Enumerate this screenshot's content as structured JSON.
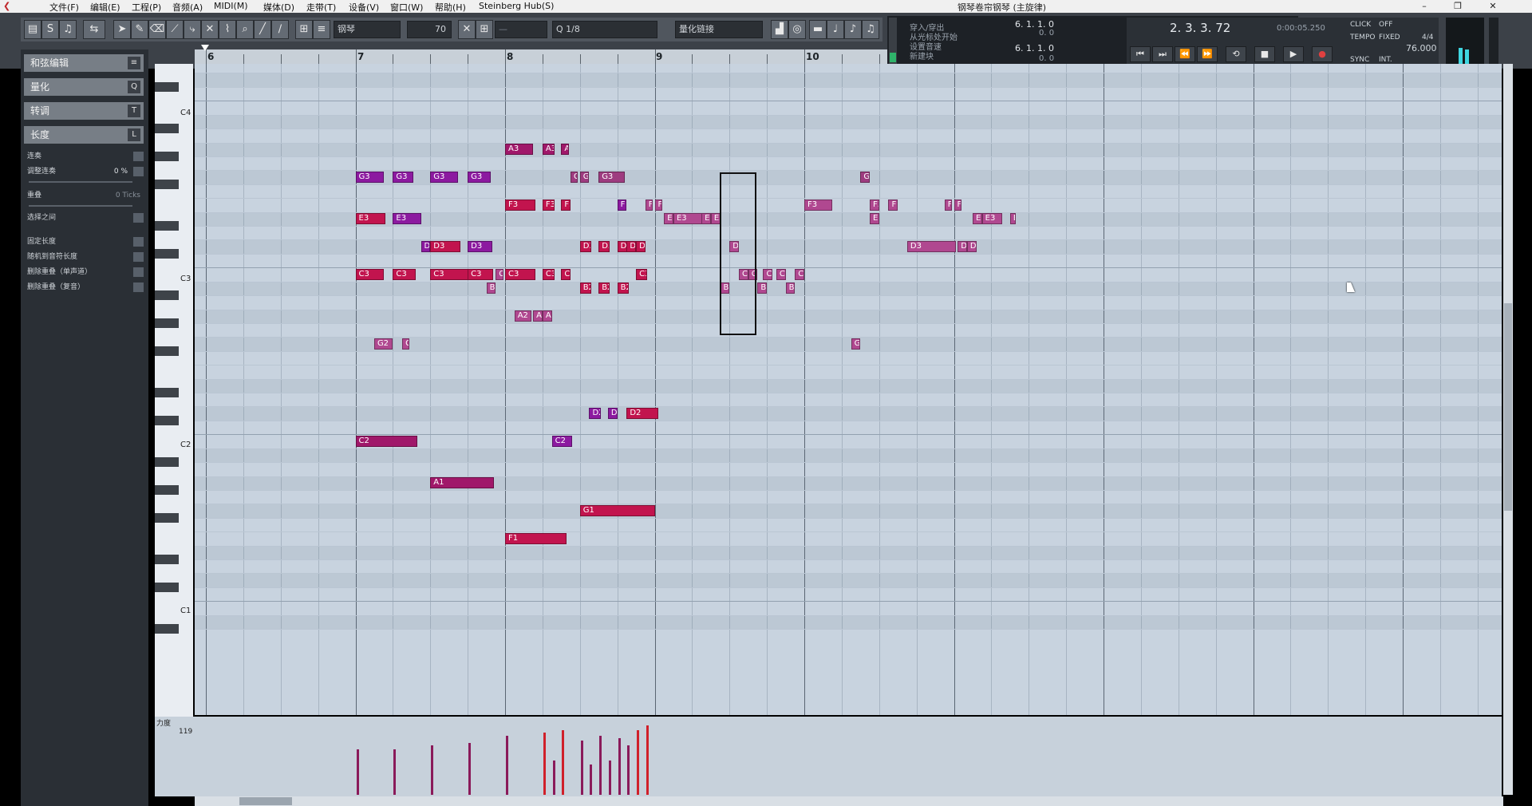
{
  "app": {
    "window_title": "钢琴卷帘钢琴 (主旋律)",
    "menu": [
      "文件(F)",
      "编辑(E)",
      "工程(P)",
      "音频(A)",
      "MIDI(M)",
      "媒体(D)",
      "走带(T)",
      "设备(V)",
      "窗口(W)",
      "帮助(H)",
      "Steinberg Hub(S)"
    ],
    "window_buttons": [
      "–",
      "❐",
      "✕"
    ]
  },
  "toolbar": {
    "track_name": "钢琴",
    "velocity_value": "70",
    "quantize": "1/8",
    "quantize_mode": "量化链接",
    "icons": [
      "tool-arrow-icon",
      "pencil-icon",
      "eraser-icon",
      "scissors-icon",
      "glue-icon",
      "mute-icon",
      "zoom-icon",
      "line-icon"
    ]
  },
  "info_panel": {
    "rows": [
      "穿入/穿出",
      "从光标处开始",
      "设置音速",
      "新建块"
    ],
    "locator_left": "6. 1. 1.  0",
    "locator_left_sub": "0.  0",
    "locator_right": "6. 1. 1.  0",
    "locator_right_sub": "0.  0"
  },
  "transport": {
    "position": "2. 3. 3.  72",
    "time": "0:00:05.250",
    "buttons": [
      "⏮",
      "⏭",
      "⏪",
      "⏩",
      "⟲",
      "■",
      "▶",
      "●"
    ]
  },
  "click_panel": {
    "click": "CLICK",
    "click_state": "OFF",
    "tempo": "TEMPO",
    "tempo_mode": "FIXED",
    "signature": "4/4",
    "tempo_value": "76.000",
    "sync": "SYNC",
    "sync_mode": "INT."
  },
  "inspector": {
    "headers": [
      {
        "label": "和弦编辑",
        "key": "≡"
      },
      {
        "label": "量化",
        "key": "Q"
      },
      {
        "label": "转调",
        "key": "T"
      },
      {
        "label": "长度",
        "key": "L"
      }
    ],
    "rows": [
      {
        "label": "连奏",
        "value": ""
      },
      {
        "label": "调整连奏",
        "value": "0 %"
      },
      {
        "label": "重叠",
        "value": "0 Ticks"
      },
      {
        "label": "选择之间",
        "value": ""
      },
      {
        "label": "固定长度",
        "value": ""
      },
      {
        "label": "随机到音符长度",
        "value": ""
      },
      {
        "label": "删除重叠（单声道）",
        "value": ""
      },
      {
        "label": "删除重叠（复音）",
        "value": ""
      }
    ]
  },
  "keyboard": {
    "labels": [
      {
        "text": "C4",
        "row": 0
      },
      {
        "text": "C3",
        "row": 1
      },
      {
        "text": "C2",
        "row": 2
      },
      {
        "text": "C1",
        "row": 3
      }
    ]
  },
  "ruler": {
    "bars": [
      "6",
      "7",
      "8",
      "9",
      "10"
    ]
  },
  "notes": [
    {
      "n": "A3",
      "p": 21,
      "s": 0,
      "w": 0.75,
      "c": "#a0186a"
    },
    {
      "n": "A3",
      "p": 21,
      "s": 1.0,
      "w": 0.33,
      "c": "#a0186a"
    },
    {
      "n": "A3",
      "p": 21,
      "s": 1.5,
      "w": 0.2,
      "c": "#a0186a"
    },
    {
      "n": "G3",
      "p": 19,
      "s": -4,
      "w": 0.75,
      "c": "#8c1aa0"
    },
    {
      "n": "G3",
      "p": 19,
      "s": -3,
      "w": 0.55,
      "c": "#8c1aa0"
    },
    {
      "n": "G3",
      "p": 19,
      "s": -2,
      "w": 0.75,
      "c": "#8c1aa0"
    },
    {
      "n": "G3",
      "p": 19,
      "s": -1,
      "w": 0.62,
      "c": "#8c1aa0"
    },
    {
      "n": "G3",
      "p": 19,
      "s": 1.75,
      "w": 0.2,
      "c": "#9e3c80"
    },
    {
      "n": "G3",
      "p": 19,
      "s": 2.0,
      "w": 0.25,
      "c": "#9e3c80"
    },
    {
      "n": "G3",
      "p": 19,
      "s": 2.5,
      "w": 0.7,
      "c": "#9e3c80"
    },
    {
      "n": "G3",
      "p": 19,
      "s": 9.5,
      "w": 0.25,
      "c": "#9e3c80"
    },
    {
      "n": "F3",
      "p": 17,
      "s": 0,
      "w": 0.8,
      "c": "#c2144e"
    },
    {
      "n": "F3",
      "p": 17,
      "s": 1.0,
      "w": 0.33,
      "c": "#c2144e"
    },
    {
      "n": "F3",
      "p": 17,
      "s": 1.5,
      "w": 0.25,
      "c": "#c2144e"
    },
    {
      "n": "F3",
      "p": 17,
      "s": 3.0,
      "w": 0.25,
      "c": "#8c1aa0"
    },
    {
      "n": "F3",
      "p": 17,
      "s": 3.75,
      "w": 0.2,
      "c": "#b04890"
    },
    {
      "n": "F3",
      "p": 17,
      "s": 4.0,
      "w": 0.2,
      "c": "#b04890"
    },
    {
      "n": "F3",
      "p": 17,
      "s": 8.0,
      "w": 0.75,
      "c": "#b04890"
    },
    {
      "n": "F3",
      "p": 17,
      "s": 9.75,
      "w": 0.25,
      "c": "#b04890"
    },
    {
      "n": "F3",
      "p": 17,
      "s": 10.25,
      "w": 0.25,
      "c": "#b04890"
    },
    {
      "n": "F3",
      "p": 17,
      "s": 11.75,
      "w": 0.2,
      "c": "#b04890"
    },
    {
      "n": "F3",
      "p": 17,
      "s": 12.0,
      "w": 0.2,
      "c": "#b04890"
    },
    {
      "n": "E3",
      "p": 16,
      "s": -4,
      "w": 0.8,
      "c": "#c2144e"
    },
    {
      "n": "E3",
      "p": 16,
      "s": -3,
      "w": 0.75,
      "c": "#8c1aa0"
    },
    {
      "n": "E3",
      "p": 16,
      "s": 4.25,
      "w": 0.25,
      "c": "#b04890"
    },
    {
      "n": "E3",
      "p": 16,
      "s": 4.5,
      "w": 0.85,
      "c": "#b04890"
    },
    {
      "n": "E3",
      "p": 16,
      "s": 5.25,
      "w": 0.25,
      "c": "#b04890"
    },
    {
      "n": "E3",
      "p": 16,
      "s": 5.5,
      "w": 0.25,
      "c": "#b04890"
    },
    {
      "n": "E3",
      "p": 16,
      "s": 9.75,
      "w": 0.25,
      "c": "#b04890"
    },
    {
      "n": "E3",
      "p": 16,
      "s": 12.5,
      "w": 0.25,
      "c": "#b04890"
    },
    {
      "n": "E3",
      "p": 16,
      "s": 12.75,
      "w": 0.55,
      "c": "#b04890"
    },
    {
      "n": "E3",
      "p": 16,
      "s": 13.5,
      "w": 0.15,
      "c": "#b04890"
    },
    {
      "n": "D3",
      "p": 14,
      "s": -2.25,
      "w": 0.25,
      "c": "#8c1aa0"
    },
    {
      "n": "D3",
      "p": 14,
      "s": -2,
      "w": 0.8,
      "c": "#c2144e"
    },
    {
      "n": "D3",
      "p": 14,
      "s": -1,
      "w": 0.65,
      "c": "#8c1aa0"
    },
    {
      "n": "D3",
      "p": 14,
      "s": 2.0,
      "w": 0.3,
      "c": "#c2144e"
    },
    {
      "n": "D3",
      "p": 14,
      "s": 2.5,
      "w": 0.3,
      "c": "#c2144e"
    },
    {
      "n": "D3",
      "p": 14,
      "s": 3.0,
      "w": 0.3,
      "c": "#c2144e"
    },
    {
      "n": "D3",
      "p": 14,
      "s": 3.25,
      "w": 0.25,
      "c": "#c2144e"
    },
    {
      "n": "D3",
      "p": 14,
      "s": 3.5,
      "w": 0.25,
      "c": "#c2144e"
    },
    {
      "n": "D3",
      "p": 14,
      "s": 6.0,
      "w": 0.25,
      "c": "#b04890"
    },
    {
      "n": "D3",
      "p": 14,
      "s": 10.75,
      "w": 1.3,
      "c": "#b04890"
    },
    {
      "n": "D3",
      "p": 14,
      "s": 12.1,
      "w": 0.25,
      "c": "#b04890"
    },
    {
      "n": "D3",
      "p": 14,
      "s": 12.35,
      "w": 0.25,
      "c": "#b04890"
    },
    {
      "n": "C3",
      "p": 12,
      "s": -4,
      "w": 0.75,
      "c": "#c2144e"
    },
    {
      "n": "C3",
      "p": 12,
      "s": -3,
      "w": 0.62,
      "c": "#c2144e"
    },
    {
      "n": "C3",
      "p": 12,
      "s": -2,
      "w": 1.45,
      "c": "#c2144e"
    },
    {
      "n": "C3",
      "p": 12,
      "s": -1,
      "w": 0.68,
      "c": "#c2144e"
    },
    {
      "n": "C3",
      "p": 12,
      "s": -0.25,
      "w": 0.2,
      "c": "#b04890"
    },
    {
      "n": "C3",
      "p": 12,
      "s": 0,
      "w": 0.8,
      "c": "#c2144e"
    },
    {
      "n": "C3",
      "p": 12,
      "s": 1.0,
      "w": 0.33,
      "c": "#c2144e"
    },
    {
      "n": "C3",
      "p": 12,
      "s": 1.5,
      "w": 0.25,
      "c": "#c2144e"
    },
    {
      "n": "C3",
      "p": 12,
      "s": 3.5,
      "w": 0.3,
      "c": "#c2144e"
    },
    {
      "n": "C3",
      "p": 12,
      "s": 6.25,
      "w": 0.25,
      "c": "#b04890"
    },
    {
      "n": "C3",
      "p": 12,
      "s": 6.5,
      "w": 0.25,
      "c": "#b04890"
    },
    {
      "n": "C3",
      "p": 12,
      "s": 6.9,
      "w": 0.25,
      "c": "#b04890"
    },
    {
      "n": "C3",
      "p": 12,
      "s": 7.25,
      "w": 0.25,
      "c": "#b04890"
    },
    {
      "n": "C3",
      "p": 12,
      "s": 7.75,
      "w": 0.25,
      "c": "#b04890"
    },
    {
      "n": "B2",
      "p": 11,
      "s": -0.5,
      "w": 0.25,
      "c": "#b04890"
    },
    {
      "n": "B2",
      "p": 11,
      "s": 2.0,
      "w": 0.3,
      "c": "#c2144e"
    },
    {
      "n": "B2",
      "p": 11,
      "s": 2.5,
      "w": 0.3,
      "c": "#c2144e"
    },
    {
      "n": "B2",
      "p": 11,
      "s": 3.0,
      "w": 0.3,
      "c": "#c2144e"
    },
    {
      "n": "B2",
      "p": 11,
      "s": 5.75,
      "w": 0.25,
      "c": "#b04890"
    },
    {
      "n": "B2",
      "p": 11,
      "s": 6.75,
      "w": 0.25,
      "c": "#b04890"
    },
    {
      "n": "B2",
      "p": 11,
      "s": 7.5,
      "w": 0.25,
      "c": "#b04890"
    },
    {
      "n": "A2",
      "p": 9,
      "s": 0.25,
      "w": 0.45,
      "c": "#b04890"
    },
    {
      "n": "A2",
      "p": 9,
      "s": 0.75,
      "w": 0.25,
      "c": "#b04890"
    },
    {
      "n": "A2",
      "p": 9,
      "s": 1.0,
      "w": 0.25,
      "c": "#b04890"
    },
    {
      "n": "G2",
      "p": 7,
      "s": -3.5,
      "w": 0.5,
      "c": "#b04890"
    },
    {
      "n": "G2",
      "p": 7,
      "s": -2.75,
      "w": 0.2,
      "c": "#b04890"
    },
    {
      "n": "G2",
      "p": 7,
      "s": 9.25,
      "w": 0.25,
      "c": "#b04890"
    },
    {
      "n": "D2",
      "p": 2,
      "s": 2.25,
      "w": 0.3,
      "c": "#8c1aa0"
    },
    {
      "n": "D2",
      "p": 2,
      "s": 2.75,
      "w": 0.25,
      "c": "#8c1aa0"
    },
    {
      "n": "D2",
      "p": 2,
      "s": 3.25,
      "w": 0.85,
      "c": "#c2144e"
    },
    {
      "n": "C2",
      "p": 0,
      "s": -4,
      "w": 1.65,
      "c": "#a0186a"
    },
    {
      "n": "C2",
      "p": 0,
      "s": 1.25,
      "w": 0.55,
      "c": "#8c1aa0"
    },
    {
      "n": "A1",
      "p": -3,
      "s": -2,
      "w": 1.7,
      "c": "#a0186a"
    },
    {
      "n": "G1",
      "p": -5,
      "s": 2.0,
      "w": 2.0,
      "c": "#c2144e"
    },
    {
      "n": "F1",
      "p": -7,
      "s": 0,
      "w": 1.65,
      "c": "#c2144e"
    }
  ],
  "velocity": {
    "label": "力度",
    "max": "119",
    "bars": [
      {
        "s": -4,
        "v": 0.6
      },
      {
        "s": -3,
        "v": 0.6
      },
      {
        "s": -2,
        "v": 0.65
      },
      {
        "s": -1,
        "v": 0.68
      },
      {
        "s": 0,
        "v": 0.78
      },
      {
        "s": 1.0,
        "v": 0.82
      },
      {
        "s": 1.25,
        "v": 0.45
      },
      {
        "s": 1.5,
        "v": 0.85
      },
      {
        "s": 2.0,
        "v": 0.72
      },
      {
        "s": 2.25,
        "v": 0.4
      },
      {
        "s": 2.5,
        "v": 0.78
      },
      {
        "s": 2.75,
        "v": 0.45
      },
      {
        "s": 3.0,
        "v": 0.75
      },
      {
        "s": 3.25,
        "v": 0.65
      },
      {
        "s": 3.5,
        "v": 0.85
      },
      {
        "s": 3.75,
        "v": 0.92
      }
    ]
  },
  "colors": {
    "grid_bg": "#c8d3df",
    "accent": "#c2144e"
  }
}
